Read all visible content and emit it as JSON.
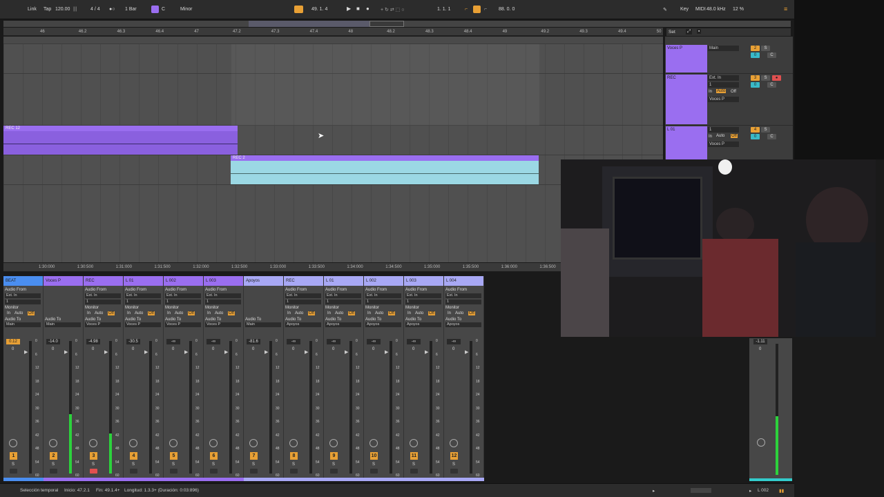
{
  "transport": {
    "link": "Link",
    "tap": "Tap",
    "tempo": "120.00",
    "signature": "4 / 4",
    "quantize": "1 Bar",
    "key": "C",
    "scale": "Minor",
    "position": "49.  1.  4",
    "loop_start": "1.  1.  1",
    "loop_len": "88.  0.  0",
    "key_btn": "Key",
    "midi_btn": "MIDI",
    "sample_rate": "48.0 kHz",
    "cpu": "12 %"
  },
  "ruler": {
    "ticks": [
      "46",
      "46.2",
      "46.3",
      "46.4",
      "47",
      "47.2",
      "47.3",
      "47.4",
      "48",
      "48.2",
      "48.3",
      "48.4",
      "49",
      "49.2",
      "49.3",
      "49.4",
      "50"
    ],
    "set_label": "Set"
  },
  "time_ruler": {
    "ticks": [
      "1:30:000",
      "1:30:500",
      "1:31:000",
      "1:31:500",
      "1:32:000",
      "1:32:500",
      "1:33:000",
      "1:33:500",
      "1:34:000",
      "1:34:500",
      "1:35:000",
      "1:35:500",
      "1:36:000",
      "1:36:500"
    ]
  },
  "clips": [
    {
      "name": "REC 12",
      "color": "#9a6ef0"
    },
    {
      "name": "REC 2",
      "color": "#9bd8e4"
    }
  ],
  "track_headers": [
    {
      "name": "Voces P",
      "route": "Main",
      "num": "2",
      "vol": "0",
      "pan": "C"
    },
    {
      "name": "REC",
      "route": "Ext. In",
      "sub": "1",
      "mon": [
        "In",
        "Auto",
        "Off"
      ],
      "out": "Voces P",
      "num": "3",
      "vol": "0",
      "pan": "C"
    },
    {
      "name": "L 01",
      "route": "1",
      "mon": [
        "In",
        "Auto",
        "Off"
      ],
      "out": "Voces P",
      "num": "4",
      "vol": "0",
      "pan": "C"
    }
  ],
  "mixer": {
    "labels": {
      "audio_from": "Audio From",
      "monitor": "Monitor",
      "audio_to": "Audio To",
      "in": "In",
      "auto": "Auto",
      "off": "Off",
      "solo": "S"
    },
    "strips": [
      {
        "name": "BEAT",
        "color": "#4a8ef0",
        "from": "Ext. In",
        "sub": "1",
        "to": "Main",
        "vol": "0.12",
        "pan": "0",
        "num": "1",
        "meter": 0
      },
      {
        "name": "Voces P",
        "color": "#9a6ef0",
        "from": "",
        "sub": "",
        "to": "Main",
        "vol": "-14.0",
        "pan": "0",
        "num": "2",
        "meter": 0.45
      },
      {
        "name": "REC",
        "color": "#9a6ef0",
        "from": "Ext. In",
        "sub": "1",
        "to": "Voces P",
        "vol": "-4.98",
        "pan": "0",
        "num": "3",
        "meter": 0.3
      },
      {
        "name": "L 01",
        "color": "#9a6ef0",
        "from": "Ext. In",
        "sub": "1",
        "to": "Voces P",
        "vol": "-30.5",
        "pan": "0",
        "num": "4",
        "meter": 0
      },
      {
        "name": "L 002",
        "color": "#9a6ef0",
        "from": "Ext. In",
        "sub": "1",
        "to": "Voces P",
        "vol": "-∞",
        "pan": "0",
        "num": "5",
        "meter": 0
      },
      {
        "name": "L 003",
        "color": "#9a6ef0",
        "from": "Ext. In",
        "sub": "1",
        "to": "Voces P",
        "vol": "-∞",
        "pan": "0",
        "num": "6",
        "meter": 0
      },
      {
        "name": "Apoyos",
        "color": "#a8a8f5",
        "from": "",
        "sub": "",
        "to": "Main",
        "vol": "-81.6",
        "pan": "0",
        "num": "7",
        "meter": 0
      },
      {
        "name": "REC",
        "color": "#a8a8f5",
        "from": "Ext. In",
        "sub": "1",
        "to": "Apoyos",
        "vol": "-∞",
        "pan": "0",
        "num": "8",
        "meter": 0
      },
      {
        "name": "L 01",
        "color": "#a8a8f5",
        "from": "Ext. In",
        "sub": "1",
        "to": "Apoyos",
        "vol": "-∞",
        "pan": "0",
        "num": "9",
        "meter": 0
      },
      {
        "name": "L 002",
        "color": "#a8a8f5",
        "from": "Ext. In",
        "sub": "1",
        "to": "Apoyos",
        "vol": "-∞",
        "pan": "0",
        "num": "10",
        "meter": 0
      },
      {
        "name": "L 003",
        "color": "#a8a8f5",
        "from": "Ext. In",
        "sub": "1",
        "to": "Apoyos",
        "vol": "-∞",
        "pan": "0",
        "num": "11",
        "meter": 0
      },
      {
        "name": "L 004",
        "color": "#a8a8f5",
        "from": "Ext. In",
        "sub": "1",
        "to": "Apoyos",
        "vol": "-∞",
        "pan": "0",
        "num": "12",
        "meter": 0
      }
    ],
    "scale": [
      "0",
      "6",
      "12",
      "18",
      "24",
      "30",
      "36",
      "42",
      "48",
      "54",
      "60"
    ]
  },
  "master": {
    "vol": "-1.11",
    "pan": "0",
    "meter": 0.45
  },
  "status": {
    "selection": "Selección temporal",
    "start": "Inicio: 47.2.1",
    "end": "Fin: 49.1.4+",
    "length": "Longitud: 1.3.3+ (Duración: 0:03:896)",
    "track": "L 002"
  }
}
